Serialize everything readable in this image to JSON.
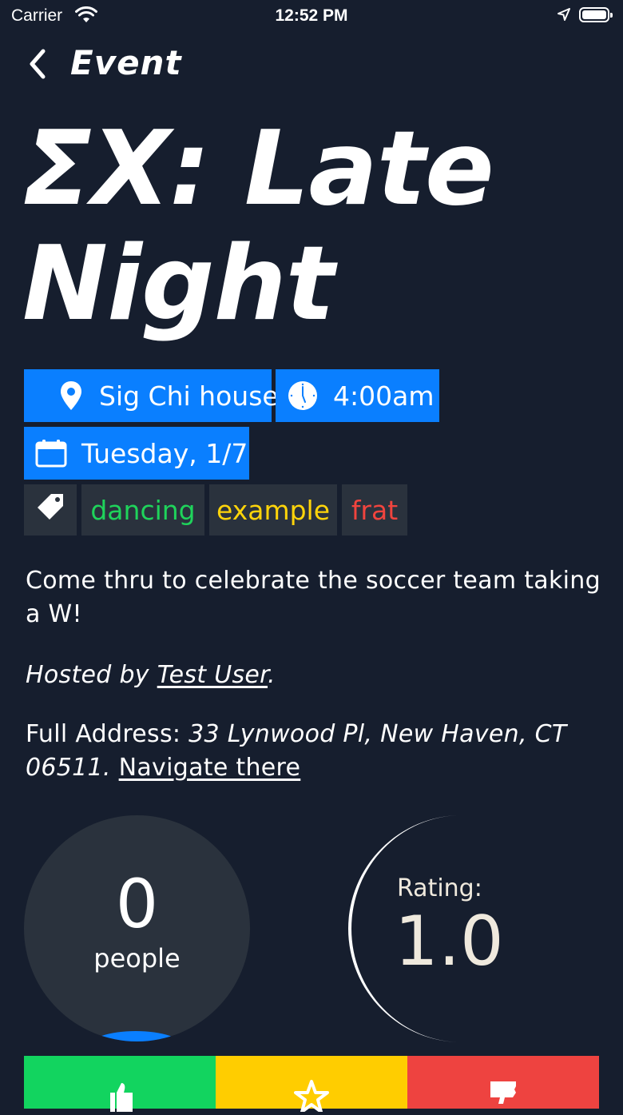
{
  "status_bar": {
    "carrier": "Carrier",
    "time": "12:52 PM"
  },
  "nav": {
    "title": "Event"
  },
  "event": {
    "title": "ΣX: Late Night",
    "location": "Sig Chi house",
    "time": "4:00am",
    "date": "Tuesday, 1/7",
    "tags": [
      {
        "label": "dancing",
        "color": "#1fd35b"
      },
      {
        "label": "example",
        "color": "#ffd40a"
      },
      {
        "label": "frat",
        "color": "#f0443e"
      }
    ],
    "description": "Come thru to celebrate the soccer team taking a W!",
    "host_prefix": "Hosted by ",
    "host_name": "Test User",
    "host_suffix": ".",
    "address_prefix": "Full Address: ",
    "address": "33 Lynwood Pl, New Haven, CT 06511.",
    "navigate_label": "Navigate there"
  },
  "stats": {
    "people_count": "0",
    "people_label": "people",
    "rating_label": "Rating:",
    "rating_value": "1.0"
  },
  "colors": {
    "background": "#161e2e",
    "accent_blue": "#0a7fff",
    "tag_bg": "#2a323d",
    "like_green": "#12d45f",
    "favorite_yellow": "#ffcd00",
    "dislike_red": "#ee4340",
    "moon": "#ffffff"
  },
  "icons": {
    "location": "map-pin-icon",
    "time": "clock-icon",
    "date": "calendar-icon",
    "tags": "tag-icon",
    "like": "thumbs-up-icon",
    "favorite": "star-icon",
    "dislike": "thumbs-down-icon"
  }
}
